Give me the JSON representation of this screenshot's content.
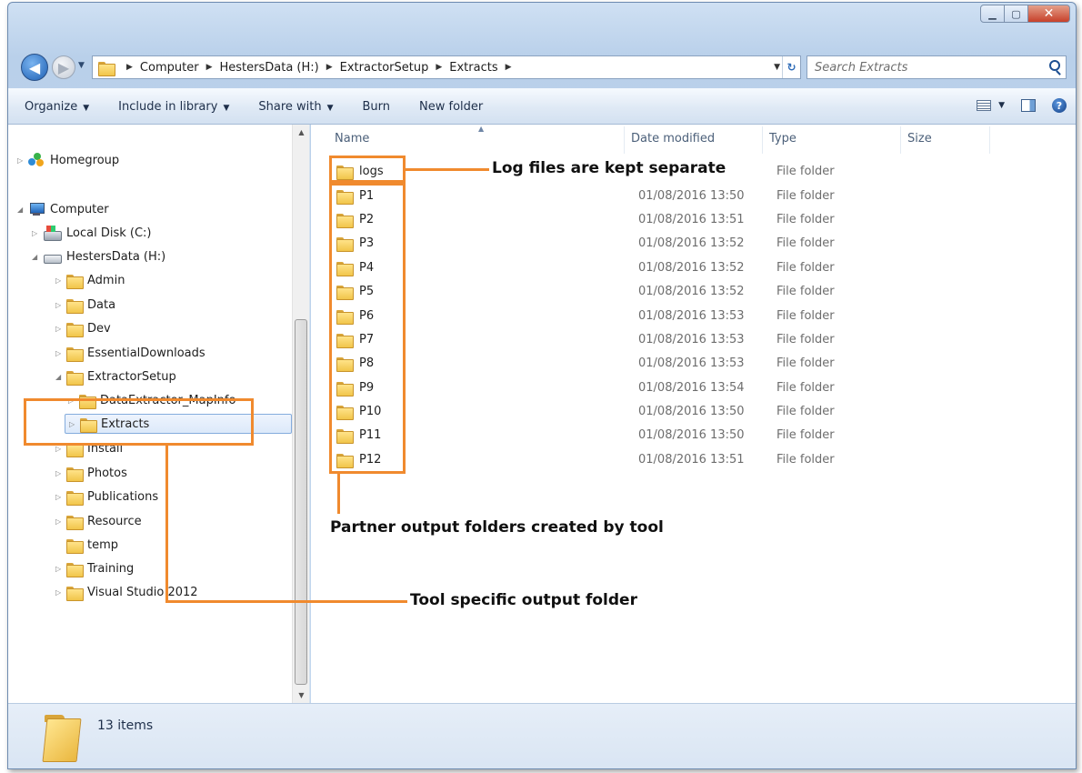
{
  "window": {
    "caption_buttons": [
      "minimize",
      "maximize",
      "close"
    ]
  },
  "address_bar": {
    "crumbs": [
      "Computer",
      "HestersData (H:)",
      "ExtractorSetup",
      "Extracts"
    ]
  },
  "search": {
    "placeholder": "Search Extracts"
  },
  "toolbar": {
    "organize": "Organize",
    "include_in_library": "Include in library",
    "share_with": "Share with",
    "burn": "Burn",
    "new_folder": "New folder"
  },
  "nav_pane": {
    "homegroup": "Homegroup",
    "computer": "Computer",
    "local_disk": "Local Disk (C:)",
    "hesters_data": "HestersData (H:)",
    "folders": [
      "Admin",
      "Data",
      "Dev",
      "EssentialDownloads",
      "ExtractorSetup",
      "DataExtractor_MapInfo",
      "Extracts",
      "Install",
      "Photos",
      "Publications",
      "Resource",
      "temp",
      "Training",
      "Visual Studio 2012"
    ]
  },
  "columns": {
    "name": "Name",
    "date_modified": "Date modified",
    "type": "Type",
    "size": "Size"
  },
  "files": [
    {
      "name": "logs",
      "date": "",
      "type": "File folder"
    },
    {
      "name": "P1",
      "date": "01/08/2016 13:50",
      "type": "File folder"
    },
    {
      "name": "P2",
      "date": "01/08/2016 13:51",
      "type": "File folder"
    },
    {
      "name": "P3",
      "date": "01/08/2016 13:52",
      "type": "File folder"
    },
    {
      "name": "P4",
      "date": "01/08/2016 13:52",
      "type": "File folder"
    },
    {
      "name": "P5",
      "date": "01/08/2016 13:52",
      "type": "File folder"
    },
    {
      "name": "P6",
      "date": "01/08/2016 13:53",
      "type": "File folder"
    },
    {
      "name": "P7",
      "date": "01/08/2016 13:53",
      "type": "File folder"
    },
    {
      "name": "P8",
      "date": "01/08/2016 13:53",
      "type": "File folder"
    },
    {
      "name": "P9",
      "date": "01/08/2016 13:54",
      "type": "File folder"
    },
    {
      "name": "P10",
      "date": "01/08/2016 13:50",
      "type": "File folder"
    },
    {
      "name": "P11",
      "date": "01/08/2016 13:50",
      "type": "File folder"
    },
    {
      "name": "P12",
      "date": "01/08/2016 13:51",
      "type": "File folder"
    }
  ],
  "status": {
    "item_count": "13 items"
  },
  "annotations": {
    "logs_note": "Log files are kept separate",
    "partner_note": "Partner output folders created by tool",
    "tool_note": "Tool specific output folder",
    "highlight_color": "#f08a2e"
  }
}
